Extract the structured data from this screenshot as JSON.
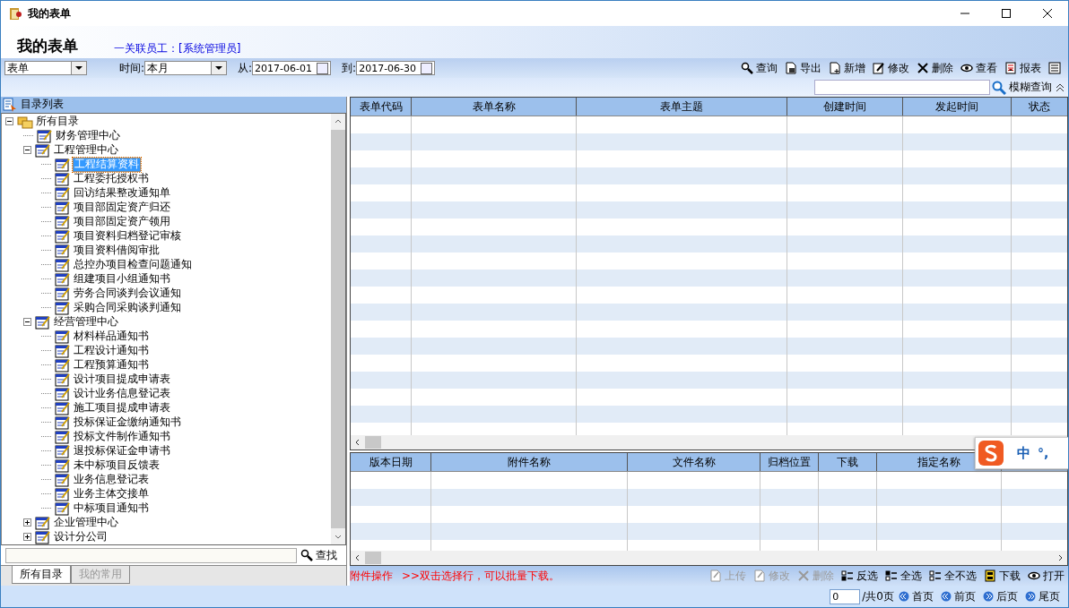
{
  "window": {
    "title": "我的表单"
  },
  "header": {
    "title": "我的表单",
    "user": "一关联员工：[系统管理员]"
  },
  "filters": {
    "type_select": "表单",
    "time_label": "时间:",
    "time_select": "本月",
    "from_label": "从:",
    "from_date": "2017-06-01",
    "to_label": "到:",
    "to_date": "2017-06-30"
  },
  "toolbar": [
    {
      "kind": "search",
      "label": "查询"
    },
    {
      "kind": "export",
      "label": "导出"
    },
    {
      "kind": "add",
      "label": "新增"
    },
    {
      "kind": "edit",
      "label": "修改"
    },
    {
      "kind": "delete",
      "label": "删除"
    },
    {
      "kind": "view",
      "label": "查看"
    },
    {
      "kind": "report",
      "label": "报表"
    },
    {
      "kind": "grid"
    }
  ],
  "fuzzy_search": {
    "label": "模糊查询"
  },
  "sidebar": {
    "title": "目录列表",
    "find_label": "查找",
    "tree": [
      {
        "label": "所有目录",
        "expanded": true,
        "selected": false,
        "children": [
          {
            "label": "财务管理中心",
            "selected": false
          },
          {
            "label": "工程管理中心",
            "expanded": true,
            "selected": false,
            "children": [
              {
                "label": "工程结算资料",
                "selected": true
              },
              {
                "label": "工程委托授权书",
                "selected": false
              },
              {
                "label": "回访结果整改通知单",
                "selected": false
              },
              {
                "label": "项目部固定资产归还",
                "selected": false
              },
              {
                "label": "项目部固定资产领用",
                "selected": false
              },
              {
                "label": "项目资料归档登记审核",
                "selected": false
              },
              {
                "label": "项目资料借阅审批",
                "selected": false
              },
              {
                "label": "总控办项目检查问题通知",
                "selected": false
              },
              {
                "label": "组建项目小组通知书",
                "selected": false
              },
              {
                "label": "劳务合同谈判会议通知",
                "selected": false
              },
              {
                "label": "采购合同采购谈判通知",
                "selected": false
              }
            ]
          },
          {
            "label": "经营管理中心",
            "expanded": true,
            "selected": false,
            "children": [
              {
                "label": "材料样品通知书",
                "selected": false
              },
              {
                "label": "工程设计通知书",
                "selected": false
              },
              {
                "label": "工程预算通知书",
                "selected": false
              },
              {
                "label": "设计项目提成申请表",
                "selected": false
              },
              {
                "label": "设计业务信息登记表",
                "selected": false
              },
              {
                "label": "施工项目提成申请表",
                "selected": false
              },
              {
                "label": "投标保证金缴纳通知书",
                "selected": false
              },
              {
                "label": "投标文件制作通知书",
                "selected": false
              },
              {
                "label": "退投标保证金申请书",
                "selected": false
              },
              {
                "label": "未中标项目反馈表",
                "selected": false
              },
              {
                "label": "业务信息登记表",
                "selected": false
              },
              {
                "label": "业务主体交接单",
                "selected": false
              },
              {
                "label": "中标项目通知书",
                "selected": false
              }
            ]
          },
          {
            "label": "企业管理中心",
            "expanded": false,
            "selected": false
          },
          {
            "label": "设计分公司",
            "expanded": false,
            "selected": false
          }
        ]
      }
    ],
    "tabs": [
      {
        "label": "所有目录",
        "selected": true
      },
      {
        "label": "我的常用",
        "selected": false
      }
    ]
  },
  "table": {
    "columns": [
      "表单代码",
      "表单名称",
      "表单主题",
      "创建时间",
      "发起时间",
      "状态"
    ]
  },
  "attachments": {
    "columns": [
      "版本日期",
      "附件名称",
      "文件名称",
      "归档位置",
      "下载",
      "指定名称"
    ],
    "hint_label": "附件操作",
    "hint": ">>双击选择行，可以批量下载。",
    "actions": [
      {
        "kind": "upload",
        "label": "上传",
        "disabled": true
      },
      {
        "kind": "edit",
        "label": "修改",
        "disabled": true
      },
      {
        "kind": "delete",
        "label": "删除",
        "disabled": true
      },
      {
        "kind": "invert",
        "label": "反选",
        "disabled": false
      },
      {
        "kind": "all",
        "label": "全选",
        "disabled": false
      },
      {
        "kind": "none",
        "label": "全不选",
        "disabled": false
      },
      {
        "kind": "download",
        "label": "下载",
        "disabled": false
      },
      {
        "kind": "open",
        "label": "打开",
        "disabled": false
      }
    ]
  },
  "pager": {
    "page": "0",
    "total": "/共0页",
    "buttons": [
      "首页",
      "前页",
      "后页",
      "尾页"
    ]
  },
  "ime": {
    "mode": "中",
    "punct": "°,"
  }
}
